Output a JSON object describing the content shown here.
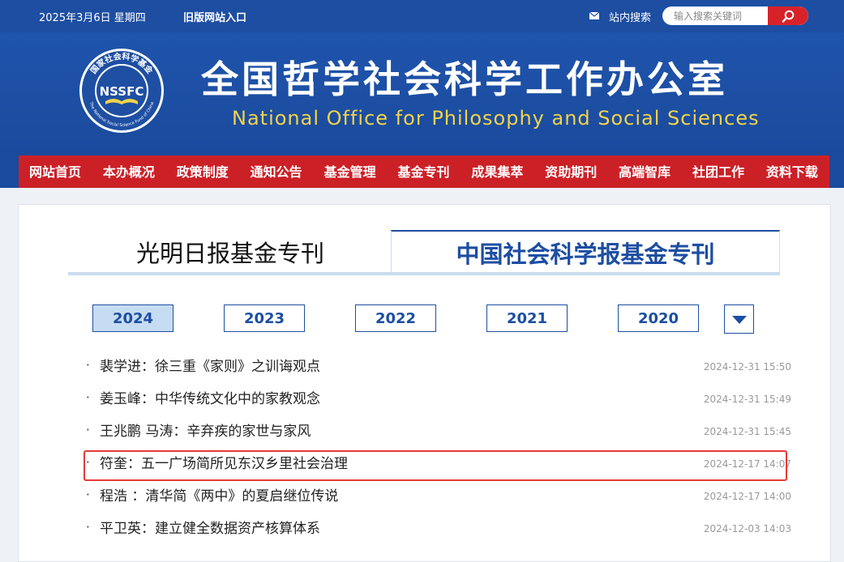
{
  "topbar": {
    "date": "2025年3月6日 星期四",
    "old_site_link": "旧版网站入口",
    "site_search_label": "站内搜索",
    "search_placeholder": "输入搜索关键词",
    "icons": [
      "mail-icon",
      "search-icon"
    ]
  },
  "header": {
    "title_cn": "全国哲学社会科学工作办公室",
    "title_en": "National Office for Philosophy and Social Sciences",
    "logo": {
      "center_text": "NSSFC",
      "ring_text_top": "国家社会科学基金",
      "ring_text_bottom": "The National Social Science Fund of China"
    }
  },
  "nav": {
    "items": [
      "网站首页",
      "本办概况",
      "政策制度",
      "通知公告",
      "基金管理",
      "基金专刊",
      "成果集萃",
      "资助期刊",
      "高端智库",
      "社团工作",
      "资料下载"
    ]
  },
  "tabs": {
    "items": [
      "光明日报基金专刊",
      "中国社会科学报基金专刊"
    ],
    "active_index": 1
  },
  "years": {
    "items": [
      "2024",
      "2023",
      "2022",
      "2021",
      "2020"
    ],
    "active": "2024",
    "more_icon": "caret-down-icon"
  },
  "articles": [
    {
      "bullet": "·",
      "title": "裴学进：徐三重《家则》之训诲观点",
      "time": "2024-12-31 15:50"
    },
    {
      "bullet": "·",
      "title": "姜玉峰：中华传统文化中的家教观念",
      "time": "2024-12-31 15:49"
    },
    {
      "bullet": "·",
      "title": "王兆鹏 马涛：辛弃疾的家世与家风",
      "time": "2024-12-31 15:45"
    },
    {
      "bullet": "·",
      "title": "符奎：五一广场简所见东汉乡里社会治理",
      "time": "2024-12-17 14:07",
      "highlighted": true
    },
    {
      "bullet": "·",
      "title": "程浩 ：清华简《两中》的夏启继位传说",
      "time": "2024-12-17 14:00"
    },
    {
      "bullet": "·",
      "title": "平卫英：建立健全数据资产核算体系",
      "time": "2024-12-03 14:03"
    }
  ],
  "colors": {
    "primary_blue": "#1d4ea2",
    "nav_red": "#cc2027",
    "title_en_gold": "#f3d34a",
    "active_year_bg": "#c5dcf2",
    "highlight_red": "#e63a36"
  }
}
